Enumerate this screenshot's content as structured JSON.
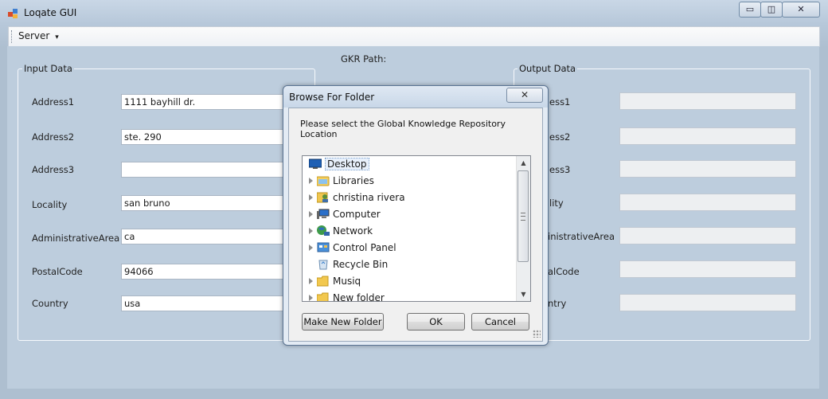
{
  "window": {
    "title": "Loqate GUI",
    "controls": {
      "minimize": "▭",
      "restore": "◫",
      "close": "✕"
    }
  },
  "menu": {
    "server_label": "Server",
    "server_arrow": "▾"
  },
  "gkr_path_label": "GKR Path:",
  "input_group": {
    "title": "Input Data",
    "fields": [
      {
        "label": "Address1",
        "value": "1111 bayhill dr."
      },
      {
        "label": "Address2",
        "value": "ste. 290"
      },
      {
        "label": "Address3",
        "value": ""
      },
      {
        "label": "Locality",
        "value": "san bruno"
      },
      {
        "label": "AdministrativeArea",
        "value": "ca"
      },
      {
        "label": "PostalCode",
        "value": "94066"
      },
      {
        "label": "Country",
        "value": "usa"
      }
    ]
  },
  "output_group": {
    "title": "Output Data",
    "partial_labels": [
      "ess1",
      "ess2",
      "ess3",
      "lity",
      "inistrativeArea",
      "alCode",
      "ntry"
    ]
  },
  "dialog": {
    "title": "Browse For Folder",
    "close": "✕",
    "description": "Please select the Global Knowledge Repository Location",
    "tree_items": [
      {
        "label": "Desktop",
        "icon": "desktop-icon"
      },
      {
        "label": "Libraries",
        "icon": "libraries-icon"
      },
      {
        "label": "christina rivera",
        "icon": "user-folder-icon"
      },
      {
        "label": "Computer",
        "icon": "computer-icon"
      },
      {
        "label": "Network",
        "icon": "network-icon"
      },
      {
        "label": "Control Panel",
        "icon": "control-panel-icon"
      },
      {
        "label": "Recycle Bin",
        "icon": "recycle-bin-icon"
      },
      {
        "label": "Musiq",
        "icon": "folder-icon"
      },
      {
        "label": "New folder",
        "icon": "folder-icon"
      }
    ],
    "buttons": {
      "make_new_folder": "Make New Folder",
      "ok": "OK",
      "cancel": "Cancel"
    }
  }
}
